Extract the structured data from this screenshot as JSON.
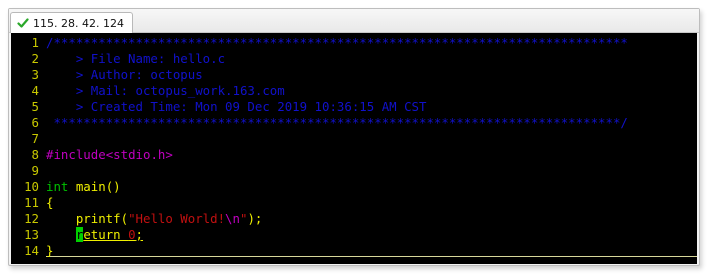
{
  "tab": {
    "title": "115. 28. 42. 124",
    "icon": "check-icon",
    "icon_color": "#2aa82a"
  },
  "colors": {
    "background": "#000000",
    "line_number": "#c9c900",
    "comment": "#1111cc",
    "preprocessor": "#c000c0",
    "string": "#c01010",
    "type": "#00c000",
    "identifier": "#f0f000"
  },
  "lines": [
    {
      "num": "1",
      "tokens": [
        {
          "t": "/*****************************************************************************",
          "c": "c-comment"
        }
      ]
    },
    {
      "num": "2",
      "tokens": [
        {
          "t": "    > File Name: hello.c",
          "c": "c-comment"
        }
      ]
    },
    {
      "num": "3",
      "tokens": [
        {
          "t": "    > Author: octopus",
          "c": "c-comment"
        }
      ]
    },
    {
      "num": "4",
      "tokens": [
        {
          "t": "    > Mail: octopus_work.163.com",
          "c": "c-comment"
        }
      ]
    },
    {
      "num": "5",
      "tokens": [
        {
          "t": "    > Created Time: Mon 09 Dec 2019 10:36:15 AM CST",
          "c": "c-comment"
        }
      ]
    },
    {
      "num": "6",
      "tokens": [
        {
          "t": " ****************************************************************************/",
          "c": "c-comment"
        }
      ]
    },
    {
      "num": "7",
      "tokens": []
    },
    {
      "num": "8",
      "tokens": [
        {
          "t": "#include",
          "c": "c-pre"
        },
        {
          "t": "<stdio.h>",
          "c": "c-inc"
        }
      ]
    },
    {
      "num": "9",
      "tokens": []
    },
    {
      "num": "10",
      "tokens": [
        {
          "t": "int",
          "c": "c-type"
        },
        {
          "t": " main()",
          "c": "c-plain"
        }
      ]
    },
    {
      "num": "11",
      "tokens": [
        {
          "t": "{",
          "c": "c-plain"
        }
      ]
    },
    {
      "num": "12",
      "tokens": [
        {
          "t": "    printf(",
          "c": "c-plain"
        },
        {
          "t": "\"Hello World!",
          "c": "c-str"
        },
        {
          "t": "\\n",
          "c": "c-esc"
        },
        {
          "t": "\"",
          "c": "c-str"
        },
        {
          "t": ");",
          "c": "c-plain"
        }
      ]
    },
    {
      "num": "13",
      "tokens": [
        {
          "t": "    ",
          "c": "c-plain"
        },
        {
          "t": "r",
          "c": "cursor"
        },
        {
          "t": "eturn ",
          "c": "c-kw underline"
        },
        {
          "t": "0",
          "c": "c-num underline"
        },
        {
          "t": ";",
          "c": "c-plain underline"
        }
      ]
    },
    {
      "num": "14",
      "tokens": [
        {
          "t": "}",
          "c": "c-plain"
        }
      ]
    }
  ]
}
